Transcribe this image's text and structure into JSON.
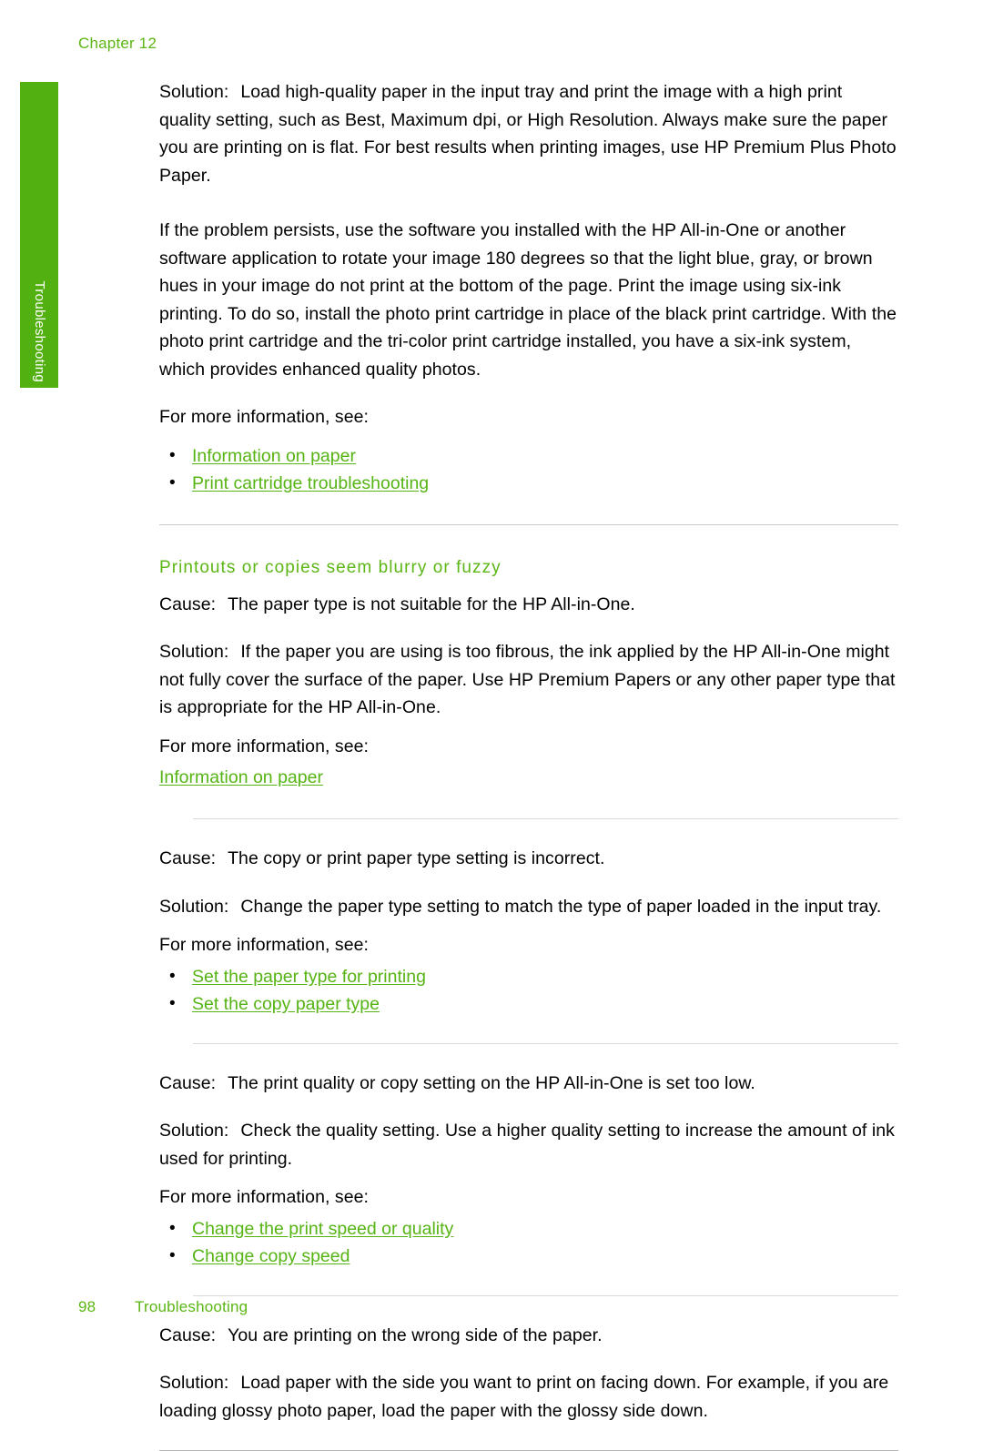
{
  "page": {
    "running_head": "Chapter 12",
    "side_tab_label": "Troubleshooting",
    "accent_green": "#5cb615",
    "link_green": "#56b414",
    "tab_green": "#52b010"
  },
  "intro": {
    "solution_label": "Solution:",
    "solution_text": "Load high-quality paper in the input tray and print the image with a high print quality setting, such as Best, Maximum dpi, or High Resolution. Always make sure the paper you are printing on is flat. For best results when printing images, use HP Premium Plus Photo Paper.",
    "persist_text": "If the problem persists, use the software you installed with the HP All-in-One or another software application to rotate your image 180 degrees so that the light blue, gray, or brown hues in your image do not print at the bottom of the page. Print the image using six-ink printing. To do so, install the photo print cartridge in place of the black print cartridge. With the photo print cartridge and the tri-color print cartridge installed, you have a six-ink system, which provides enhanced quality photos.",
    "more_info": "For more information, see:",
    "links": [
      "Information on paper",
      "Print cartridge troubleshooting"
    ]
  },
  "section": {
    "title": "Printouts or copies seem blurry or fuzzy",
    "cause_label": "Cause:",
    "solution_label": "Solution:",
    "more_info": "For more information, see:",
    "blocks": [
      {
        "cause": "The paper type is not suitable for the HP All-in-One.",
        "solution": "If the paper you are using is too fibrous, the ink applied by the HP All-in-One might not fully cover the surface of the paper. Use HP Premium Papers or any other paper type that is appropriate for the HP All-in-One.",
        "links": [
          "Information on paper"
        ],
        "bulleted": false
      },
      {
        "cause": "The copy or print paper type setting is incorrect.",
        "solution": "Change the paper type setting to match the type of paper loaded in the input tray.",
        "links": [
          "Set the paper type for printing",
          "Set the copy paper type"
        ],
        "bulleted": true
      },
      {
        "cause": "The print quality or copy setting on the HP All-in-One is set too low.",
        "solution": "Check the quality setting. Use a higher quality setting to increase the amount of ink used for printing.",
        "links": [
          "Change the print speed or quality",
          "Change copy speed"
        ],
        "bulleted": true
      },
      {
        "cause": "You are printing on the wrong side of the paper.",
        "solution": "Load paper with the side you want to print on facing down. For example, if you are loading glossy photo paper, load the paper with the glossy side down.",
        "links": [],
        "bulleted": false
      }
    ]
  },
  "footer": {
    "page_number": "98",
    "section_name": "Troubleshooting"
  },
  "bullet_glyph": "•"
}
